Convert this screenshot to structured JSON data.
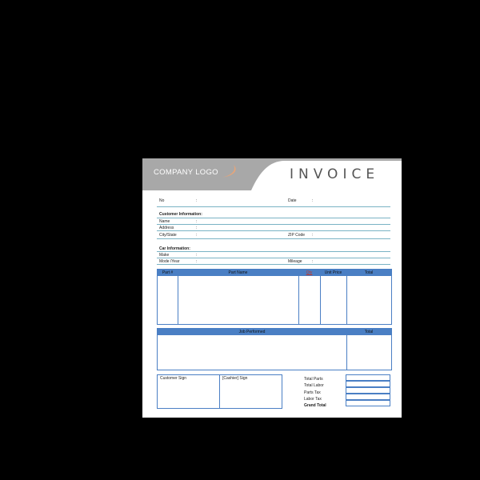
{
  "header": {
    "logo": "COMPANY LOGO",
    "title": "INVOICE"
  },
  "meta": {
    "no_label": "No",
    "date_label": "Date",
    "sep": ":"
  },
  "customer": {
    "heading": "Customer Information:",
    "name": "Name",
    "address": "Address",
    "city_state": "City/State",
    "zip": "ZIP Code"
  },
  "car": {
    "heading": "Car Information:",
    "make": "Make",
    "model_year": "Mode /Year",
    "mileage": "Mileage"
  },
  "parts_table": {
    "columns": [
      "Part #",
      "Part Name",
      "Qty",
      "Unit Price",
      "Total"
    ]
  },
  "jobs_table": {
    "columns": [
      "Job Performed",
      "Total"
    ]
  },
  "signatures": {
    "customer": "Customer Sign",
    "cashier": "[Cashier] Sign"
  },
  "totals": {
    "labels": [
      "Total Parts",
      "Total Labor",
      "Parts Tax",
      "Labor Tax",
      "Grand Total"
    ]
  },
  "colors": {
    "accent": "#4a7fc4",
    "header_grey": "#a8a8a8",
    "swoosh": "#e6a57a",
    "qty_red": "#c0392b"
  }
}
